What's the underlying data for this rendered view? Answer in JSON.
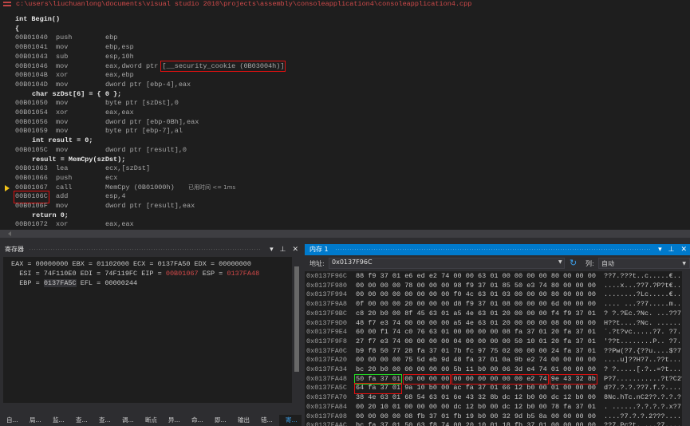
{
  "editor": {
    "path": "c:\\users\\liuchuanlong\\documents\\visual studio 2010\\projects\\assembly\\consoleapplication4\\consoleapplication4.cpp",
    "lines": [
      {
        "src": "int Begin()"
      },
      {
        "src": "{"
      },
      {
        "addr": "00B01040",
        "op": "push",
        "args": "ebp"
      },
      {
        "addr": "00B01041",
        "op": "mov",
        "args": "ebp,esp"
      },
      {
        "addr": "00B01043",
        "op": "sub",
        "args": "esp,10h"
      },
      {
        "addr": "00B01046",
        "op": "mov",
        "args": "eax,dword ptr ",
        "boxed": "[__security_cookie (0B03004h)]"
      },
      {
        "addr": "00B0104B",
        "op": "xor",
        "args": "eax,ebp"
      },
      {
        "addr": "00B0104D",
        "op": "mov",
        "args": "dword ptr [ebp-4],eax"
      },
      {
        "src": "char szDst[6] = { 0 };",
        "indent": true
      },
      {
        "addr": "00B01050",
        "op": "mov",
        "args": "byte ptr [szDst],0"
      },
      {
        "addr": "00B01054",
        "op": "xor",
        "args": "eax,eax"
      },
      {
        "addr": "00B01056",
        "op": "mov",
        "args": "dword ptr [ebp-0Bh],eax"
      },
      {
        "addr": "00B01059",
        "op": "mov",
        "args": "byte ptr [ebp-7],al"
      },
      {
        "src": "int result = 0;",
        "indent": true
      },
      {
        "addr": "00B0105C",
        "op": "mov",
        "args": "dword ptr [result],0"
      },
      {
        "src": "result = MemCpy(szDst);",
        "indent": true
      },
      {
        "addr": "00B01063",
        "op": "lea",
        "args": "ecx,[szDst]"
      },
      {
        "addr": "00B01066",
        "op": "push",
        "args": "ecx"
      },
      {
        "addr": "00B01067",
        "op": "call",
        "args": "MemCpy (0B01000h)",
        "note": "已用时间 <= 1ms",
        "current": true
      },
      {
        "addr": "00B0106C",
        "op": "add",
        "args": "esp,4",
        "addr_boxed": true
      },
      {
        "addr": "00B0106F",
        "op": "mov",
        "args": "dword ptr [result],eax"
      },
      {
        "src": "return 0;",
        "indent": true
      },
      {
        "addr": "00B01072",
        "op": "xor",
        "args": "eax,eax"
      }
    ]
  },
  "registers": {
    "title": "寄存器",
    "lines": [
      [
        {
          "t": "EAX = 00000000 EBX = 01102000 ECX = 0137FA50 EDX = 00000000"
        }
      ],
      [
        {
          "t": "  ESI = 74F110E0 EDI = 74F119FC EIP = "
        },
        {
          "t": "00B01067",
          "c": "red"
        },
        {
          "t": " ESP = "
        },
        {
          "t": "0137FA48",
          "c": "red"
        }
      ],
      [
        {
          "t": "  EBP = "
        },
        {
          "t": "0137FA5C",
          "c": "hl"
        },
        {
          "t": " EFL = 00000244"
        }
      ]
    ]
  },
  "tabs": [
    "自...",
    "局...",
    "监...",
    "查...",
    "查...",
    "调...",
    "断点",
    "异...",
    "命...",
    "即...",
    "输出",
    "错...",
    "寄..."
  ],
  "active_tab": 12,
  "memory": {
    "title": "内存 1",
    "address_label": "地址:",
    "address_value": "0x0137F96C",
    "columns_label": "列:",
    "columns_value": "自动",
    "rows": [
      {
        "addr": "0x0137F96C",
        "bytes": "88 f9 37 01 e6 ed e2 74 00 00 63 01 00 00 00 00 80 00 00 00",
        "ascii": "??7.???t..c.....€..."
      },
      {
        "addr": "0x0137F980",
        "bytes": "00 00 00 00 78 00 00 00 98 f9 37 01 85 50 e3 74 80 00 00 00",
        "ascii": "....x...??7.?P?t€..."
      },
      {
        "addr": "0x0137F994",
        "bytes": "00 00 00 00 00 00 00 00 f0 4c 63 01 03 00 00 00 80 00 00 00",
        "ascii": "........?Lc.....€..."
      },
      {
        "addr": "0x0137F9A8",
        "bytes": "0f 00 00 00 20 00 00 00 d8 f9 37 01 08 00 00 00 6d 00 00 00",
        "ascii": ".... ...??7.....m..."
      },
      {
        "addr": "0x0137F9BC",
        "bytes": "c8 20 b0 00 8f 45 63 01 a5 4e 63 01 20 00 00 00 f4 f9 37 01",
        "ascii": "? ?.?Ec.?Nc. ...??7."
      },
      {
        "addr": "0x0137F9D0",
        "bytes": "48 f7 e3 74 00 00 00 00 a5 4e 63 01 20 00 00 00 08 00 00 00",
        "ascii": "H??t....?Nc. ......."
      },
      {
        "addr": "0x0137F9E4",
        "bytes": "60 00 f1 74 c0 76 63 01 00 00 00 00 08 fa 37 01 20 fa 37 01",
        "ascii": "`.?t?vc.....?7. ?7."
      },
      {
        "addr": "0x0137F9F8",
        "bytes": "27 f7 e3 74 00 00 00 00 04 00 00 00 00 50 10 01 20 fa 37 01",
        "ascii": "'??t........P.. ?7."
      },
      {
        "addr": "0x0137FA0C",
        "bytes": "b9 f8 50 77 28 fa 37 01 7b fc 97 75 02 00 00 00 24 fa 37 01",
        "ascii": "??Pw(?7.{??u....$?7."
      },
      {
        "addr": "0x0137FA20",
        "bytes": "00 00 00 00 75 5d eb 9d 48 fa 37 01 0a 9b e2 74 00 00 00 00",
        "ascii": "....u]??H?7..??t...."
      },
      {
        "addr": "0x0137FA34",
        "bytes": "bc 20 b0 00 00 00 00 00 5b 11 b0 00 06 3d e4 74 01 00 00 00",
        "ascii": "? ?.....[.?..=?t...."
      },
      {
        "addr": "0x0137FA48",
        "bytes": "50 fa 37 01 00 00 00 00 00 00 00 00 00 00 e2 74 9e 43 32 8b",
        "ascii": "P?7...........?t?C2?",
        "marks": [
          {
            "from": 0,
            "to": 4,
            "color": "green"
          },
          {
            "from": 4,
            "to": 8,
            "color": "red"
          },
          {
            "from": 8,
            "to": 16,
            "color": "red"
          },
          {
            "from": 16,
            "to": 20,
            "color": "red"
          }
        ]
      },
      {
        "addr": "0x0137FA5C",
        "bytes": "64 fa 37 01 9a 10 b0 00 ac fa 37 01 66 12 b0 00 01 00 00 00",
        "ascii": "d?7.?.?.??7.f.?.....",
        "marks": [
          {
            "from": 0,
            "to": 4,
            "color": "red"
          }
        ]
      },
      {
        "addr": "0x0137FA70",
        "bytes": "38 4e 63 01 68 54 63 01 6e 43 32 8b dc 12 b0 00 dc 12 b0 00",
        "ascii": "8Nc.hTc.nC2??.?.?.?."
      },
      {
        "addr": "0x0137FA84",
        "bytes": "00 20 10 01 00 00 00 00 dc 12 b0 00 dc 12 b0 00 78 fa 37 01",
        "ascii": ". ......?.?.?.?.x?7."
      },
      {
        "addr": "0x0137FA98",
        "bytes": "00 00 00 00 08 fb 37 01 fb 19 b0 00 32 9d b5 8a 00 00 00 00",
        "ascii": "....?7.?.?.2???....."
      },
      {
        "addr": "0x0137FAAC",
        "bytes": "bc fa 37 01 50 63 f8 74 00 20 10 01 18 fb 37 01 00 00 00 00",
        "ascii": "??7.Pc?t. ...?7....."
      }
    ]
  }
}
